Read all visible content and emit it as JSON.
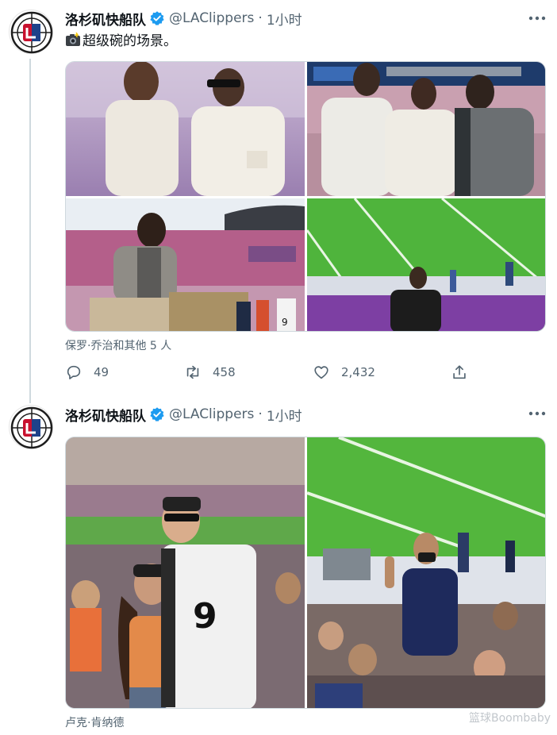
{
  "tweets": [
    {
      "author": {
        "name": "洛杉矶快船队",
        "handle": "@LAClippers",
        "time": "1小时"
      },
      "text": "超级碗的场景。",
      "emoji": "camera-flash-icon",
      "tagged": "保罗·乔治和其他 5 人",
      "stats": {
        "replies": "49",
        "retweets": "458",
        "likes": "2,432"
      },
      "photos": [
        "two players in white tees at stadium",
        "three players in stadium stands",
        "player leaning on stadium railing",
        "man on football field sideline"
      ]
    },
    {
      "author": {
        "name": "洛杉矶快船队",
        "handle": "@LAClippers",
        "time": "1小时"
      },
      "tagged": "卢克·肯纳德",
      "photos": [
        "couple in stands holding number 9 jersey",
        "man giving peace sign in crowd near field"
      ]
    }
  ],
  "watermark": "篮球Boombaby",
  "colors": {
    "verified": "#1d9bf0",
    "clippers_red": "#c8102e",
    "clippers_blue": "#1d428a",
    "secondary_text": "#536471"
  }
}
